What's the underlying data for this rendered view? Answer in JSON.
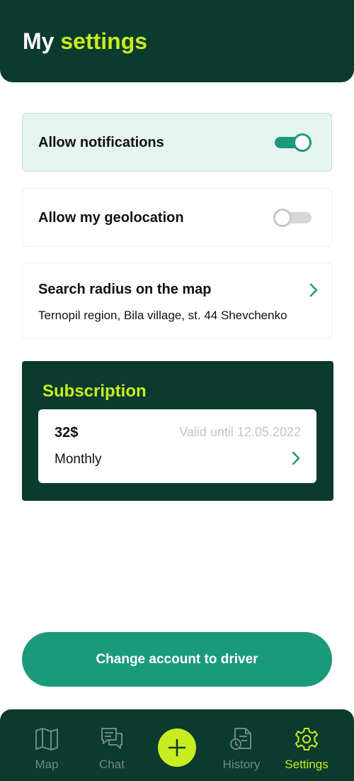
{
  "header": {
    "title_part1": "My",
    "title_part2": "settings"
  },
  "settings": {
    "notifications": {
      "label": "Allow notifications",
      "enabled": true
    },
    "geolocation": {
      "label": "Allow my geolocation",
      "enabled": false
    },
    "search_radius": {
      "label": "Search radius on the map",
      "value": "Ternopil region, Bila village, st. 44 Shevchenko"
    }
  },
  "subscription": {
    "title": "Subscription",
    "price": "32$",
    "valid_until": "Valid until 12.05.2022",
    "period": "Monthly"
  },
  "driver_button": {
    "label": "Change account to driver"
  },
  "tabbar": {
    "items": [
      {
        "label": "Map",
        "icon": "map-icon"
      },
      {
        "label": "Chat",
        "icon": "chat-icon"
      },
      {
        "label": "History",
        "icon": "history-icon"
      },
      {
        "label": "Settings",
        "icon": "gear-icon",
        "selected": true
      }
    ],
    "center_action_icon": "plus-icon"
  },
  "colors": {
    "header_bg": "#0b3a2f",
    "accent_lime": "#c8ec1f",
    "primary_green": "#1a9a7b",
    "active_card_bg": "#e6f4ef",
    "tab_inactive": "#6e8a83"
  }
}
